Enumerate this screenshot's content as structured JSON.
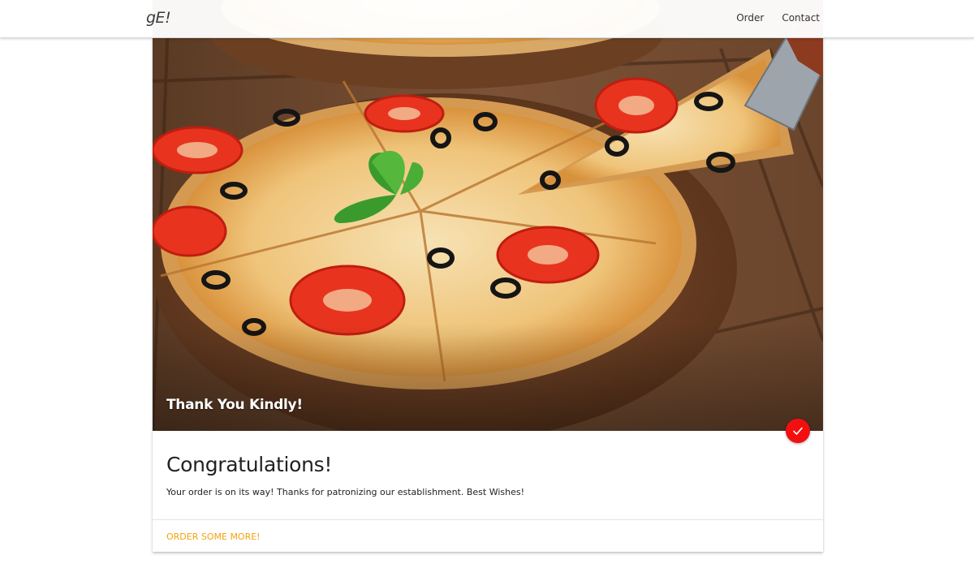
{
  "brand": "gE!",
  "nav": {
    "order": "Order",
    "contact": "Contact"
  },
  "hero": {
    "title": "Thank You Kindly!"
  },
  "card": {
    "heading": "Congratulations!",
    "message": "Your order is on its way! Thanks for patronizing our establishment. Best Wishes!",
    "action": "ORDER SOME MORE!"
  },
  "icons": {
    "status": "check-icon"
  },
  "colors": {
    "accent": "#f5a20a",
    "fab": "#f20f0f"
  }
}
